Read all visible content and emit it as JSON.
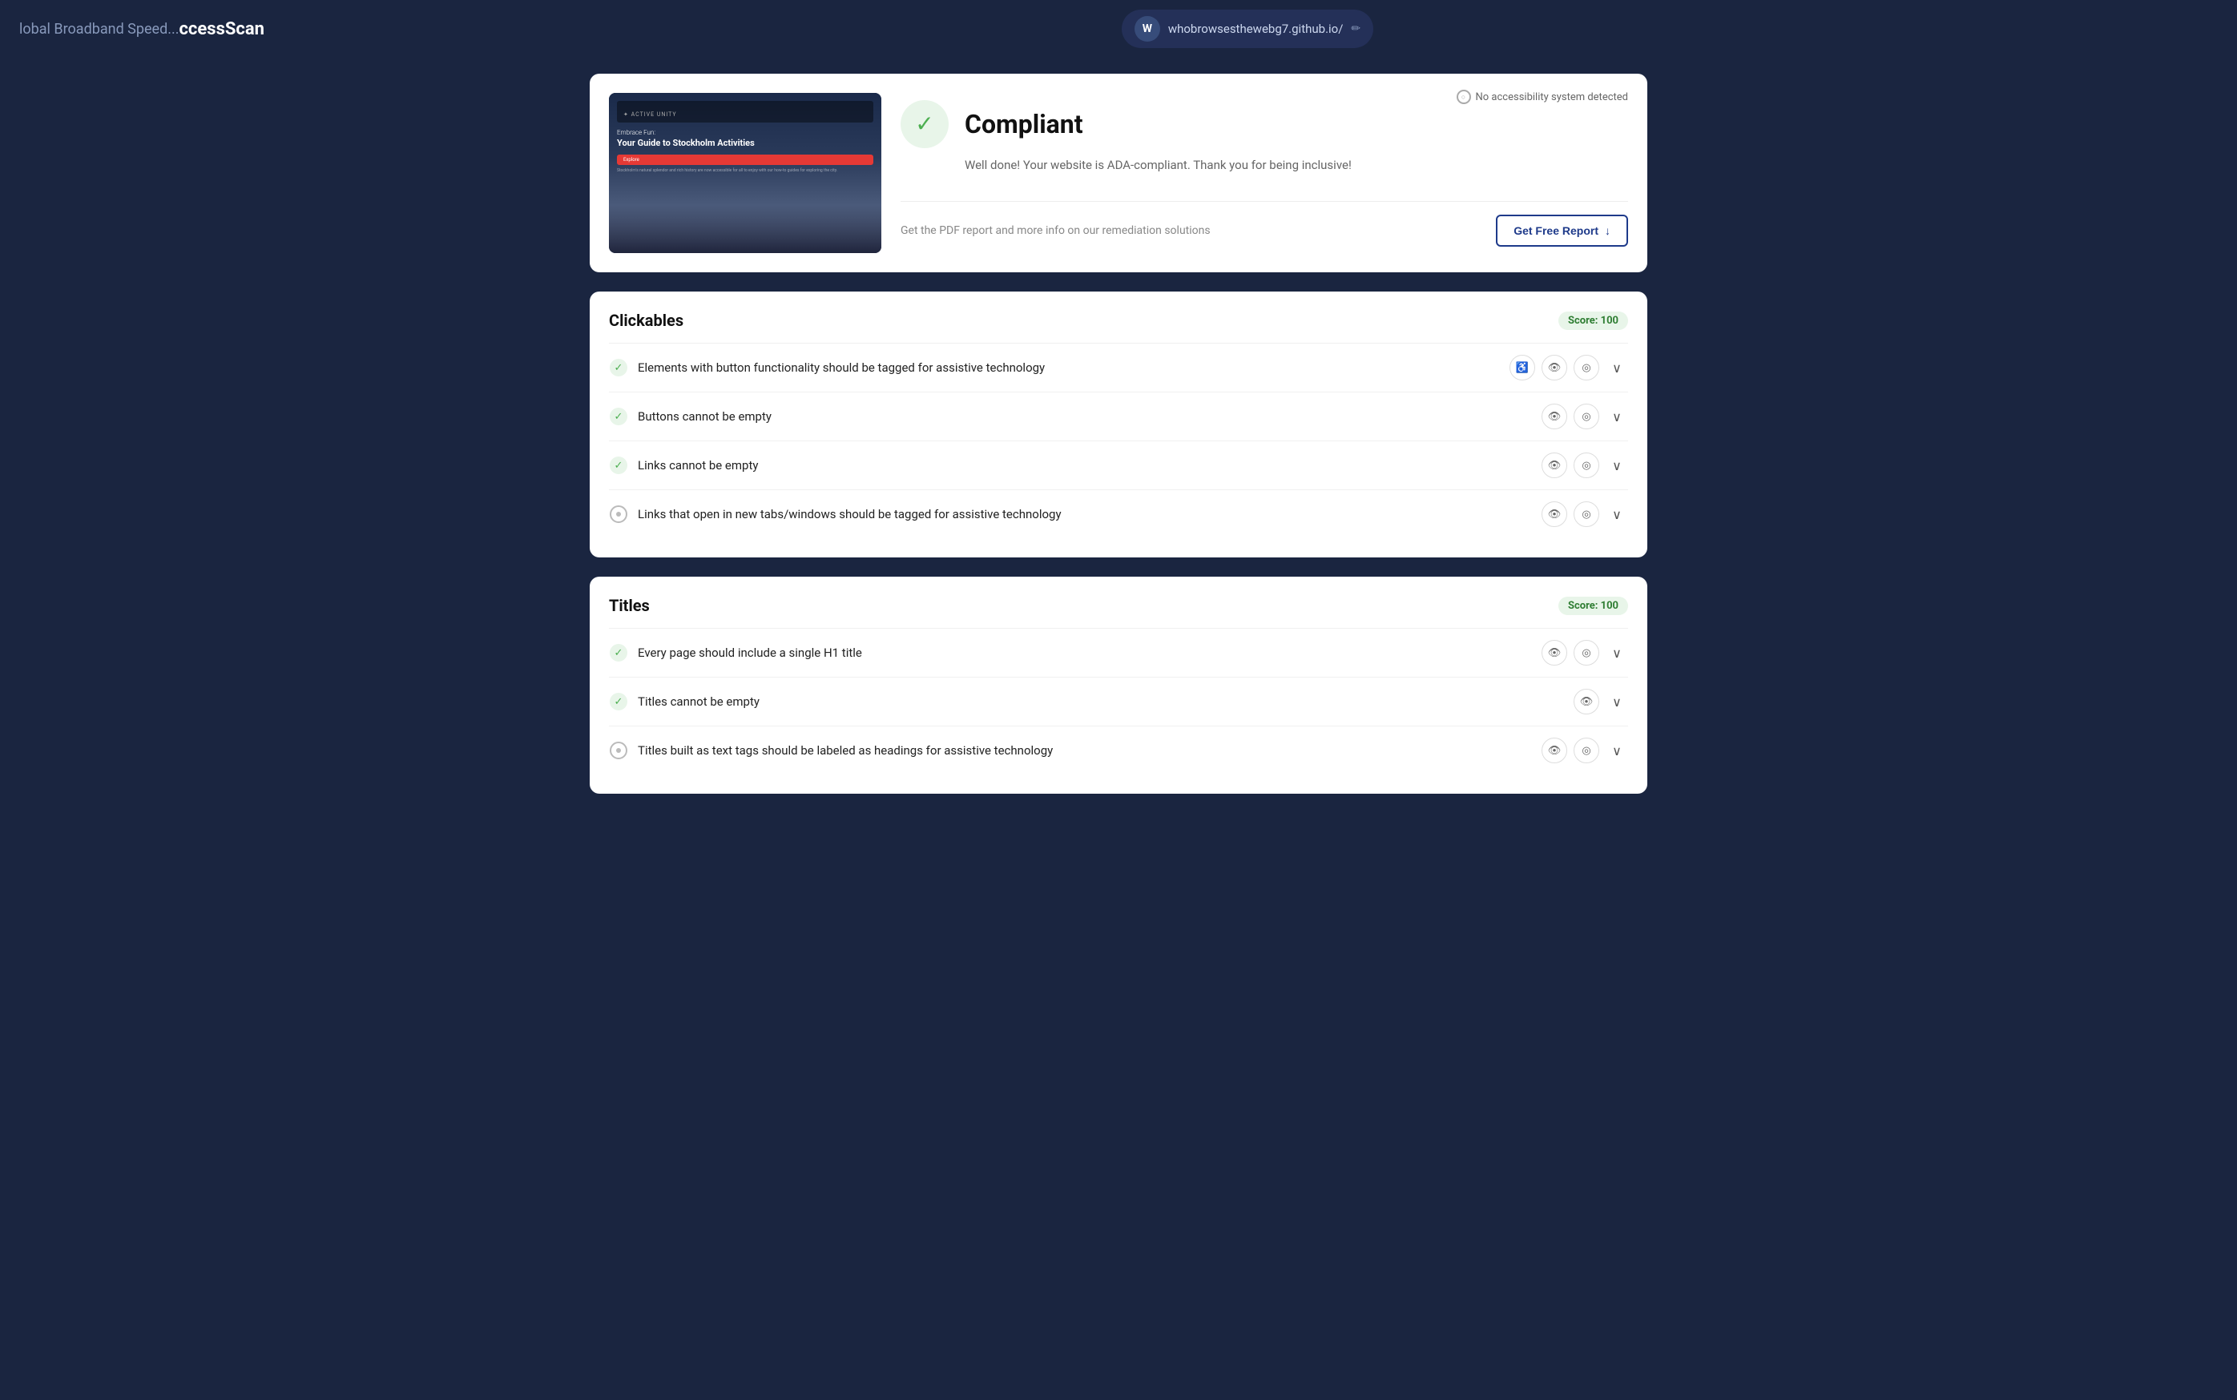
{
  "header": {
    "brand_partial": "lobal Broadband Speed...",
    "brand_name": "ccessScan",
    "url_avatar": "W",
    "url": "whobrowsesthewebg7.github.io/",
    "edit_icon": "✏"
  },
  "compliant_card": {
    "no_system_label": "No accessibility system detected",
    "status_title": "Compliant",
    "status_subtitle": "Well done! Your website is ADA-compliant. Thank you for being inclusive!",
    "report_text": "Get the PDF report and more info on our remediation solutions",
    "report_btn_label": "Get Free Report",
    "preview": {
      "logo": "✦ ACTIVE UNITY",
      "subheadline": "Embrace Fun:",
      "title": "Your Guide to Stockholm Activities",
      "btn": "Explore"
    }
  },
  "sections": [
    {
      "id": "clickables",
      "title": "Clickables",
      "score": "Score: 100",
      "items": [
        {
          "status": "check",
          "label": "Elements with button functionality should be tagged for assistive technology",
          "has_accessibility": true,
          "has_eye": true,
          "has_target": true
        },
        {
          "status": "check",
          "label": "Buttons cannot be empty",
          "has_accessibility": false,
          "has_eye": true,
          "has_target": true
        },
        {
          "status": "check",
          "label": "Links cannot be empty",
          "has_accessibility": false,
          "has_eye": true,
          "has_target": true
        },
        {
          "status": "circle",
          "label": "Links that open in new tabs/windows should be tagged for assistive technology",
          "has_accessibility": false,
          "has_eye": true,
          "has_target": true
        }
      ]
    },
    {
      "id": "titles",
      "title": "Titles",
      "score": "Score: 100",
      "items": [
        {
          "status": "check",
          "label": "Every page should include a single H1 title",
          "has_accessibility": false,
          "has_eye": true,
          "has_target": true
        },
        {
          "status": "check",
          "label": "Titles cannot be empty",
          "has_accessibility": false,
          "has_eye": true,
          "has_target": false
        },
        {
          "status": "circle",
          "label": "Titles built as text tags should be labeled as headings for assistive technology",
          "has_accessibility": false,
          "has_eye": true,
          "has_target": true
        }
      ]
    }
  ],
  "icons": {
    "check": "✓",
    "eye": "👁",
    "target": "◎",
    "chevron_down": "∨",
    "edit": "✏",
    "accessibility": "♿",
    "download": "↓",
    "dot": "●"
  }
}
